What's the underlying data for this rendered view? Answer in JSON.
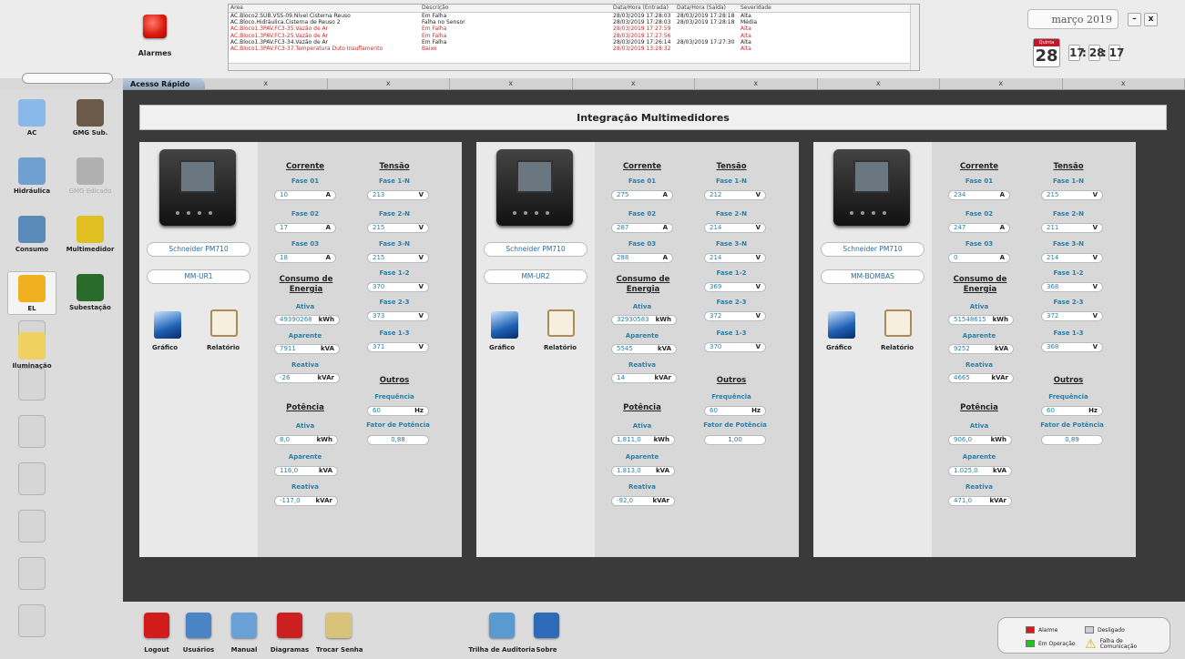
{
  "header": {
    "alarm_label": "Alarmes"
  },
  "alarm_table": {
    "columns": [
      "Área",
      "Descrição",
      "Data/Hora (Entrada)",
      "Data/Hora (Saída)",
      "Severidade"
    ],
    "rows": [
      {
        "area": "AC.Bloco2.SUB.VSS-09.Nível Cisterna Reuso",
        "desc": "Em Falha",
        "in": "28/03/2019 17:28:03",
        "out": "28/03/2019 17:28:18",
        "sev": "Alta",
        "red": false
      },
      {
        "area": "AC.Bloco.Hidráulica.Cisterna de Reuso 2",
        "desc": "Falha no Sensor",
        "in": "28/03/2019 17:28:03",
        "out": "28/03/2019 17:28:18",
        "sev": "Média",
        "red": false
      },
      {
        "area": "AC.Bloco1.3PAV.FC3-35.Vazão de Ar",
        "desc": "Em Falha",
        "in": "28/03/2019 17:27:59",
        "out": "",
        "sev": "Alta",
        "red": true
      },
      {
        "area": "AC.Bloco1.3PAV.FC3-25.Vazão de Ar",
        "desc": "Em Falha",
        "in": "28/03/2019 17:27:56",
        "out": "",
        "sev": "Alta",
        "red": true
      },
      {
        "area": "AC.Bloco1.3PAV.FC3-34.Vazão de Ar",
        "desc": "Em Falha",
        "in": "28/03/2019 17:26:14",
        "out": "28/03/2019 17:27:30",
        "sev": "Alta",
        "red": false
      },
      {
        "area": "AC.Bloco1.3PAV.FC3-37.Temperatura Duto Insuflamento",
        "desc": "Baixo",
        "in": "28/03/2019 13:28:32",
        "out": "",
        "sev": "Alta",
        "red": true
      }
    ]
  },
  "date": {
    "month": "março 2019",
    "weekday": "Quinta",
    "day": "28",
    "hh": "17",
    "mm": "28",
    "ss": "17"
  },
  "tabs": {
    "active": "Acesso Rápido",
    "close": "x"
  },
  "sidebar": [
    {
      "label": "AC",
      "icon": "snowflake-icon"
    },
    {
      "label": "GMG Sub.",
      "icon": "generator-icon"
    },
    {
      "label": "Hidráulica",
      "icon": "faucet-icon"
    },
    {
      "label": "GMG Edicado",
      "icon": "generator-disabled-icon"
    },
    {
      "label": "Consumo",
      "icon": "water-consumption-icon"
    },
    {
      "label": "Multimedidor",
      "icon": "multimeter-icon"
    },
    {
      "label": "EL",
      "icon": "lightning-icon"
    },
    {
      "label": "Subestação",
      "icon": "substation-icon"
    },
    {
      "label": "Iluminação",
      "icon": "lightbulb-icon"
    }
  ],
  "page_title": "Integração Multimedidores",
  "labels": {
    "corrente": "Corrente",
    "tensao": "Tensão",
    "fase01": "Fase 01",
    "fase02": "Fase 02",
    "fase03": "Fase 03",
    "f1n": "Fase 1-N",
    "f2n": "Fase 2-N",
    "f3n": "Fase 3-N",
    "f12": "Fase 1-2",
    "f23": "Fase 2-3",
    "f13": "Fase 1-3",
    "consumo": "Consumo de Energia",
    "ativa": "Ativa",
    "aparente": "Aparente",
    "reativa": "Reativa",
    "potencia": "Potência",
    "outros": "Outros",
    "frequencia": "Frequência",
    "fator": "Fator de Potência",
    "grafico": "Gráfico",
    "relatorio": "Relatório",
    "A": "A",
    "V": "V",
    "kWh": "kWh",
    "kVA": "kVA",
    "kVAr": "kVAr",
    "Hz": "Hz"
  },
  "meters": [
    {
      "model": "Schneider PM710",
      "name": "MM-UR1",
      "i1": "10",
      "i2": "17",
      "i3": "18",
      "v1n": "213",
      "v2n": "215",
      "v3n": "215",
      "v12": "370",
      "v23": "373",
      "v13": "371",
      "e_ativa": "49390268",
      "e_aparente": "7911",
      "e_reativa": "-26",
      "freq": "60",
      "fp": "0,88",
      "p_ativa": "8,0",
      "p_aparente": "116,0",
      "p_reativa": "-117,0"
    },
    {
      "model": "Schneider PM710",
      "name": "MM-UR2",
      "i1": "275",
      "i2": "287",
      "i3": "288",
      "v1n": "212",
      "v2n": "214",
      "v3n": "214",
      "v12": "369",
      "v23": "372",
      "v13": "370",
      "e_ativa": "32930583",
      "e_aparente": "5545",
      "e_reativa": "14",
      "freq": "60",
      "fp": "1,00",
      "p_ativa": "1.811,0",
      "p_aparente": "1.813,0",
      "p_reativa": "-92,0"
    },
    {
      "model": "Schneider PM710",
      "name": "MM-BOMBAS",
      "i1": "234",
      "i2": "247",
      "i3": "0",
      "v1n": "215",
      "v2n": "211",
      "v3n": "214",
      "v12": "368",
      "v23": "372",
      "v13": "368",
      "e_ativa": "51548615",
      "e_aparente": "9252",
      "e_reativa": "4665",
      "freq": "60",
      "fp": "0,89",
      "p_ativa": "906,0",
      "p_aparente": "1.025,0",
      "p_reativa": "471,0"
    }
  ],
  "bottom": [
    {
      "label": "Logout",
      "icon": "power-icon",
      "color": "#d21c1c"
    },
    {
      "label": "Usuários",
      "icon": "users-icon",
      "color": "#4a84c4"
    },
    {
      "label": "Manual",
      "icon": "manual-icon",
      "color": "#6aa0d8"
    },
    {
      "label": "Diagramas",
      "icon": "pdf-icon",
      "color": "#cc2020"
    },
    {
      "label": "Trocar Senha",
      "icon": "key-icon",
      "color": "#d9c27a"
    },
    {
      "label": "Trilha de Auditoria",
      "icon": "audit-clock-icon",
      "color": "#5a9ad0"
    },
    {
      "label": "Sobre",
      "icon": "info-icon",
      "color": "#2e6bb8"
    }
  ],
  "legend": {
    "alarme": "Alarme",
    "desligado": "Desligado",
    "operacao": "Em Operação",
    "falha": "Falha de Comunicação",
    "colors": {
      "alarme": "#d91a1a",
      "desligado": "#d0d0d0",
      "operacao": "#22c222",
      "falha": "#f2c200"
    }
  }
}
